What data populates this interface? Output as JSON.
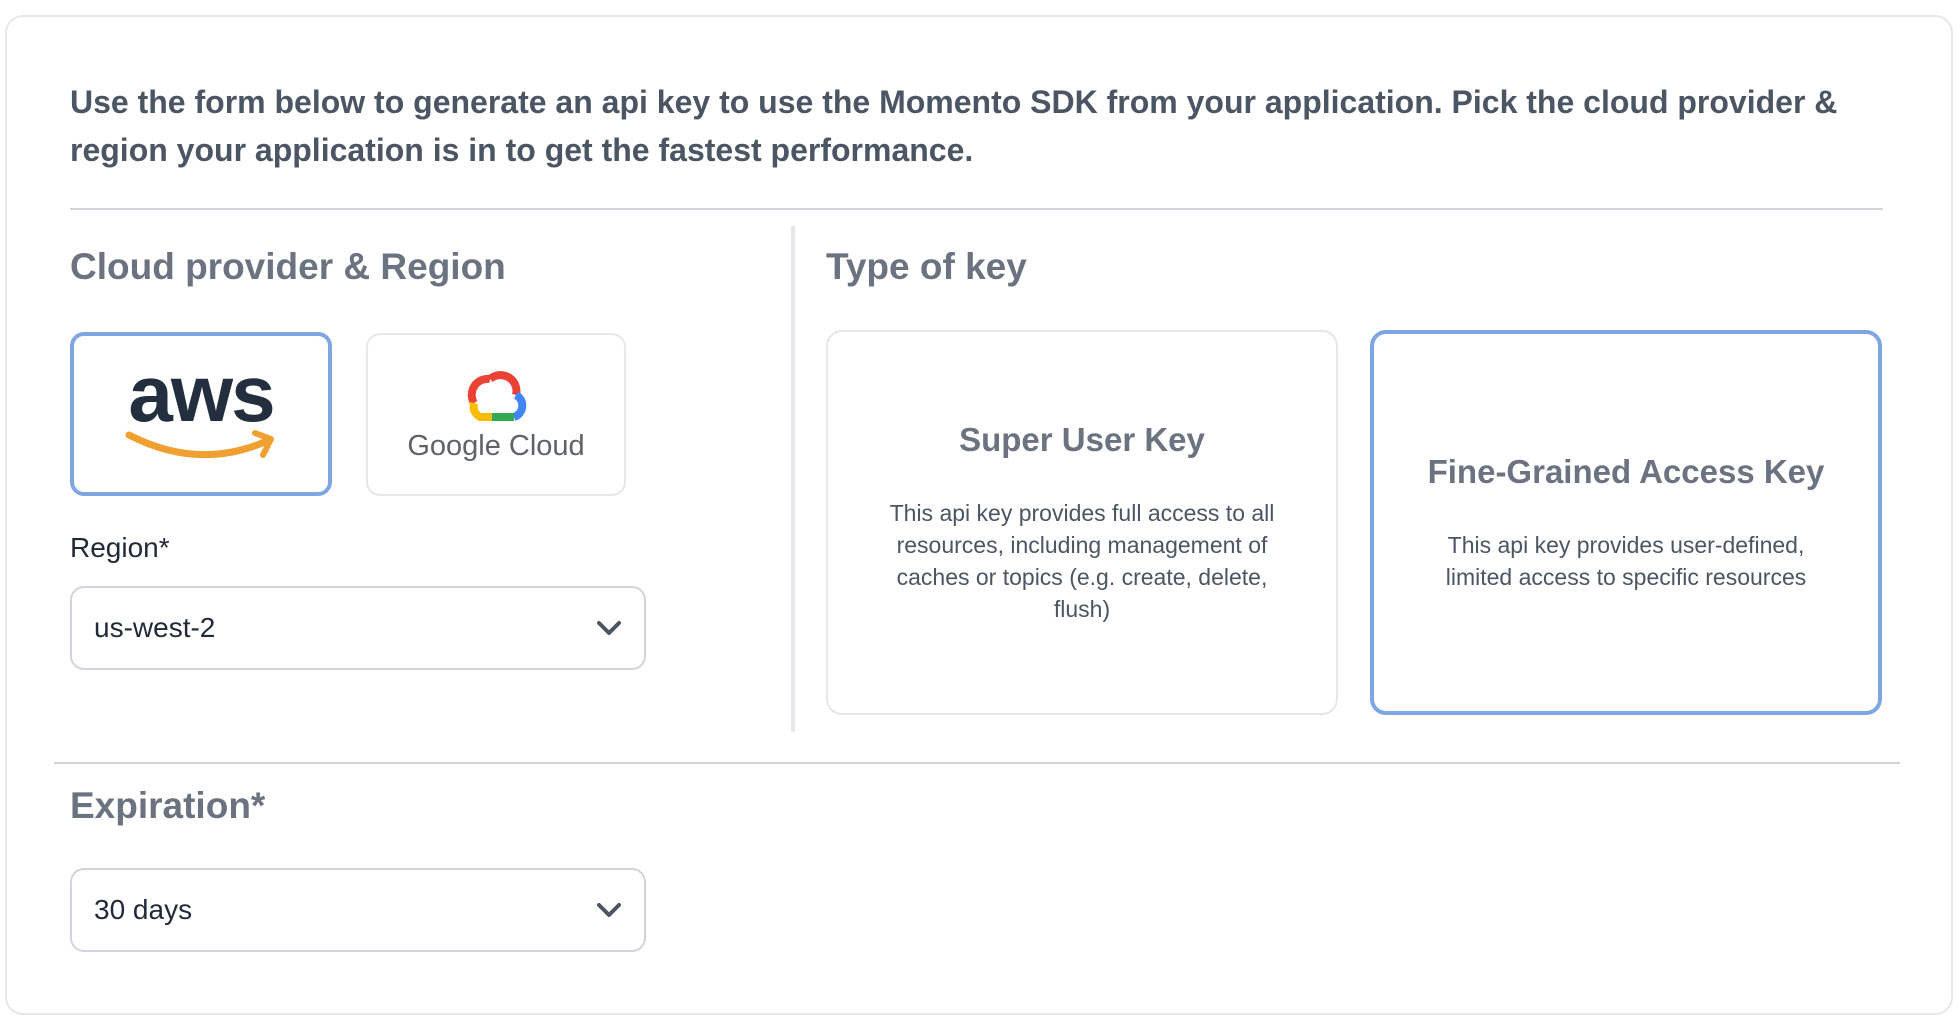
{
  "intro": "Use the form below to generate an api key to use the Momento SDK from your application. Pick the cloud provider & region your application is in to get the fastest performance.",
  "cloud_section": {
    "title": "Cloud provider & Region",
    "providers": [
      {
        "name": "aws",
        "logo_text": "aws",
        "selected": true
      },
      {
        "name": "Google Cloud",
        "logo_text": "Google Cloud",
        "selected": false
      }
    ],
    "region_label": "Region*",
    "region_value": "us-west-2"
  },
  "key_section": {
    "title": "Type of key",
    "keys": [
      {
        "title": "Super User Key",
        "description": "This api key provides full access to all resources, including management of caches or topics (e.g. create, delete, flush)",
        "selected": false
      },
      {
        "title": "Fine-Grained Access Key",
        "description": "This api key provides user-defined, limited access to specific resources",
        "selected": true
      }
    ]
  },
  "expiration": {
    "title": "Expiration*",
    "value": "30 days"
  },
  "colors": {
    "selected_border": "#7fa6e3",
    "aws_text": "#232f3e",
    "aws_smile": "#f0a030"
  }
}
